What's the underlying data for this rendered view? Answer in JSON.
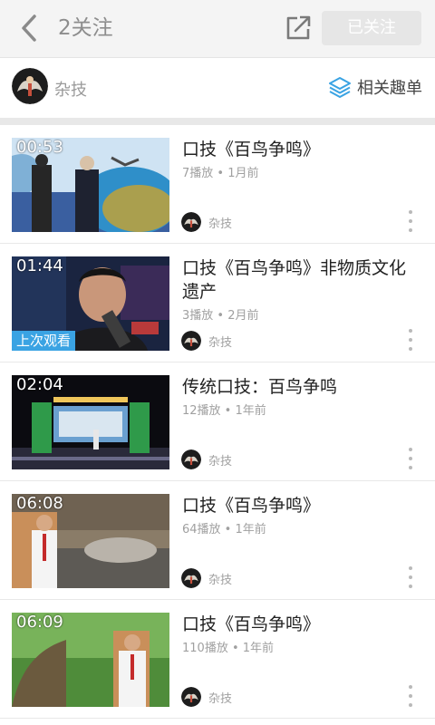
{
  "header": {
    "title": "2关注",
    "follow_label": "已关注",
    "back_icon": "chevron-left-icon",
    "share_icon": "share-icon"
  },
  "channel": {
    "name": "杂技",
    "related_label": "相关趣单",
    "related_icon": "layers-icon"
  },
  "videos": [
    {
      "duration": "00:53",
      "title": "口技《百鸟争鸣》",
      "meta": "7播放 • 1月前",
      "uploader": "杂技",
      "last_watched": ""
    },
    {
      "duration": "01:44",
      "title": "口技《百鸟争鸣》非物质文化遗产",
      "meta": "3播放 • 2月前",
      "uploader": "杂技",
      "last_watched": "上次观看"
    },
    {
      "duration": "02:04",
      "title": "传统口技：百鸟争鸣",
      "meta": "12播放 • 1年前",
      "uploader": "杂技",
      "last_watched": ""
    },
    {
      "duration": "06:08",
      "title": "口技《百鸟争鸣》",
      "meta": "64播放 • 1年前",
      "uploader": "杂技",
      "last_watched": ""
    },
    {
      "duration": "06:09",
      "title": "口技《百鸟争鸣》",
      "meta": "110播放 • 1年前",
      "uploader": "杂技",
      "last_watched": ""
    }
  ],
  "colors": {
    "accent": "#3aa3e3",
    "follow_button_bg": "#e6e6e6",
    "meta_text": "#a0a0a0"
  }
}
